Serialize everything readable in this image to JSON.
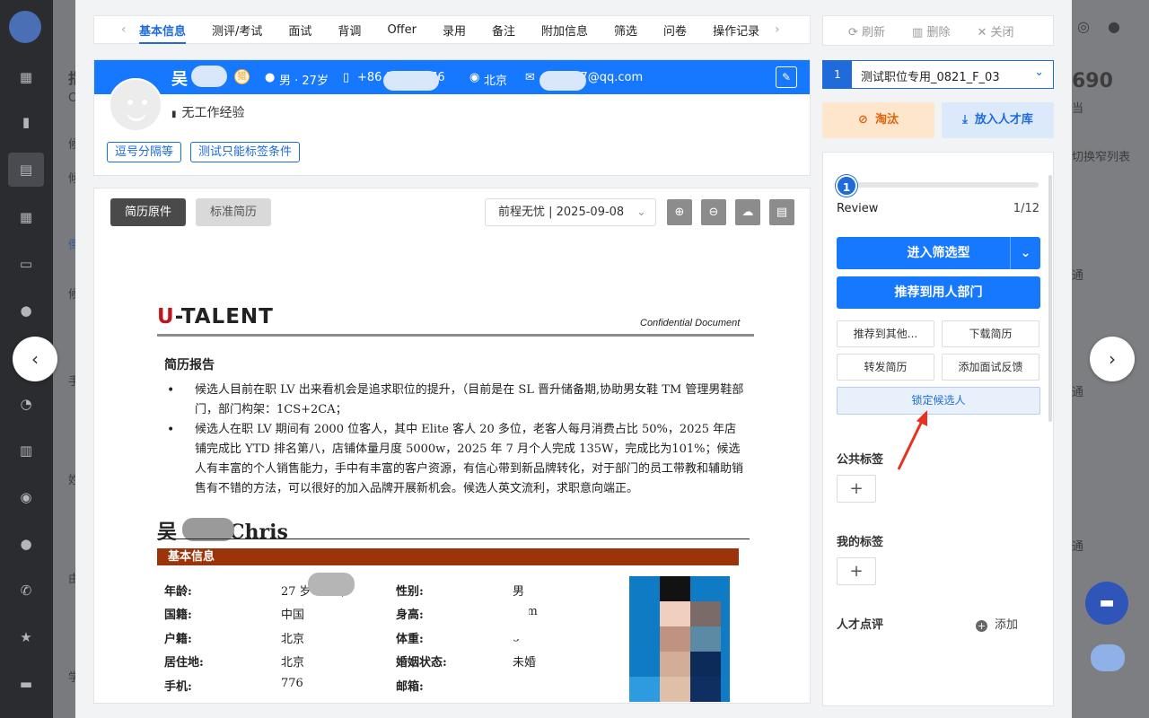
{
  "tabs": {
    "prev": "‹",
    "next": "›",
    "items": [
      "基本信息",
      "测评/考试",
      "面试",
      "背调",
      "Offer",
      "录用",
      "备注",
      "附加信息",
      "筛选",
      "问卷",
      "操作记录"
    ]
  },
  "candidate": {
    "name": "吴",
    "badge": "猎",
    "gender_age": "男 · 27岁",
    "phone": "+86 1··········76",
    "city": "北京",
    "email": "···········7@qq.com",
    "experience": "无工作经验",
    "tags": [
      "逗号分隔等",
      "测试只能标签条件"
    ]
  },
  "resume": {
    "btn_original": "简历原件",
    "btn_standard": "标准简历",
    "source_select": "前程无忧 | 2025-09-08",
    "tools": [
      "zoom-in",
      "zoom-out",
      "download",
      "note"
    ]
  },
  "doc": {
    "brand_u": "U",
    "brand_rest": "-TALENT",
    "confidential": "Confidential Document",
    "report_title": "简历报告",
    "bullets": [
      "候选人目前在职 LV 出来看机会是追求职位的提升，（目前是在 SL 晋升储备期,协助男女鞋 TM 管理男鞋部门，部门构架：1CS+2CA；",
      "候选人在职 LV 期间有 2000 位客人，其中 Elite 客人 20 多位，老客人每月消费占比 50%，2025 年店铺完成比 YTD 排名第八，店铺体量月度 5000w，2025 年 7 月个人完成 135W，完成比为101%；候选人有丰富的个人销售能力，手中有丰富的客户资源，有信心带到新品牌转化，对于部门的员工带教和辅助销售有不错的方法，可以很好的加入品牌开展新机会。候选人英文流利，求职意向端正。"
    ],
    "cname_left": "吴",
    "cname_right": "Chris",
    "section": "基本信息",
    "rows": [
      {
        "k": "年龄:",
        "v": "27 岁      3-31)",
        "k2": "性别:",
        "v2": "男"
      },
      {
        "k": "国籍:",
        "v": "中国",
        "k2": "身高:",
        "v2": "  5cm"
      },
      {
        "k": "户籍:",
        "v": "北京",
        "k2": "体重:",
        "v2": "  g"
      },
      {
        "k": "居住地:",
        "v": "北京",
        "k2": "婚姻状态:",
        "v2": "未婚"
      },
      {
        "k": "手机:",
        "v": "         776",
        "k2": "邮箱:",
        "v2": ""
      }
    ]
  },
  "right": {
    "refresh": "刷新",
    "delete": "删除",
    "close": "关闭",
    "job_index": "1",
    "job_name": "测试职位专用_0821_F_03",
    "eliminate": "淘汰",
    "to_pool": "放入人才库",
    "step_num": "1",
    "step_name": "Review",
    "step_count": "1/12",
    "enter_screen": "进入筛选型",
    "recommend_dept": "推荐到用人部门",
    "recommend_other": "推荐到其他...",
    "download_resume": "下载简历",
    "forward_resume": "转发简历",
    "add_feedback": "添加面试反馈",
    "lock_candidate": "锁定候选人",
    "public_tags": "公共标签",
    "my_tags": "我的标签",
    "talent_review": "人才点评",
    "add": "添加"
  },
  "background": {
    "number": "690",
    "toggle_text": "切换窄列表",
    "frag_dang": "当",
    "tong": [
      "通",
      "通",
      "通"
    ],
    "left_chars": [
      "指",
      "C",
      "候",
      "倾",
      "倒",
      "候",
      "手",
      "姓",
      "由",
      "学"
    ]
  },
  "colors": {
    "primary": "#1677ff",
    "brand_red": "#c4141b",
    "section_bar": "#9c3309",
    "warn_orange": "#e4610b"
  }
}
